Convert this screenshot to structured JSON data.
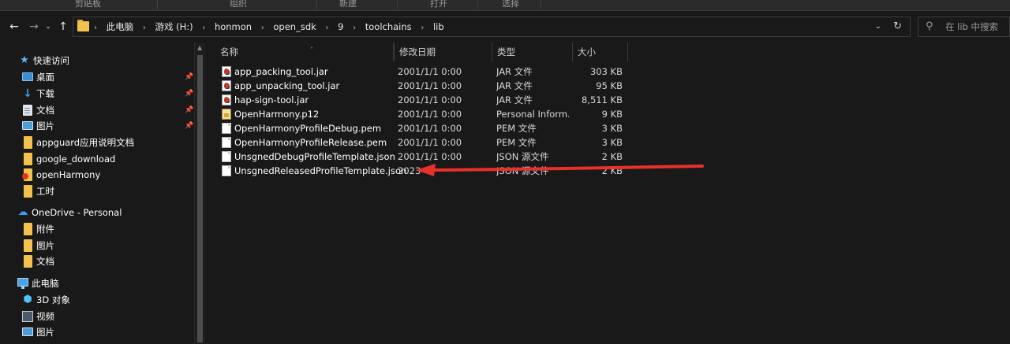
{
  "ribbon": {
    "groups": [
      "剪贴板",
      "组织",
      "新建",
      "打开",
      "选择"
    ]
  },
  "nav": {
    "back_icon": "arrow-left-icon",
    "forward_icon": "arrow-right-icon",
    "recent_icon": "chevron-down-icon",
    "up_icon": "arrow-up-icon"
  },
  "address": {
    "crumbs": [
      "此电脑",
      "游戏 (H:)",
      "honmon",
      "open_sdk",
      "9",
      "toolchains",
      "lib"
    ],
    "separator": "›"
  },
  "search": {
    "placeholder": "在 lib 中搜索"
  },
  "sidebar": {
    "quick_access": {
      "label": "快速访问",
      "items": [
        {
          "label": "桌面",
          "icon": "desktop-icon",
          "pinned": true
        },
        {
          "label": "下载",
          "icon": "download-icon",
          "pinned": true
        },
        {
          "label": "文档",
          "icon": "document-icon",
          "pinned": true
        },
        {
          "label": "图片",
          "icon": "pictures-icon",
          "pinned": true
        },
        {
          "label": "appguard应用说明文档",
          "icon": "folder-icon",
          "pinned": false
        },
        {
          "label": "google_download",
          "icon": "folder-icon",
          "pinned": false
        },
        {
          "label": "openHarmony",
          "icon": "folder-icon",
          "pinned": false
        },
        {
          "label": "工时",
          "icon": "folder-icon",
          "pinned": false
        }
      ]
    },
    "onedrive": {
      "label": "OneDrive - Personal",
      "items": [
        {
          "label": "附件",
          "icon": "folder-icon"
        },
        {
          "label": "图片",
          "icon": "folder-icon"
        },
        {
          "label": "文档",
          "icon": "folder-icon"
        }
      ]
    },
    "this_pc": {
      "label": "此电脑",
      "items": [
        {
          "label": "3D 对象",
          "icon": "3d-objects-icon"
        },
        {
          "label": "视频",
          "icon": "video-icon"
        },
        {
          "label": "图片",
          "icon": "pictures-icon"
        }
      ]
    }
  },
  "columns": {
    "name": "名称",
    "date": "修改日期",
    "type": "类型",
    "size": "大小"
  },
  "files": [
    {
      "name": "app_packing_tool.jar",
      "date": "2001/1/1 0:00",
      "type": "JAR 文件",
      "size": "303 KB",
      "icon": "jar-file-icon"
    },
    {
      "name": "app_unpacking_tool.jar",
      "date": "2001/1/1 0:00",
      "type": "JAR 文件",
      "size": "95 KB",
      "icon": "jar-file-icon"
    },
    {
      "name": "hap-sign-tool.jar",
      "date": "2001/1/1 0:00",
      "type": "JAR 文件",
      "size": "8,511 KB",
      "icon": "jar-file-icon"
    },
    {
      "name": "OpenHarmony.p12",
      "date": "2001/1/1 0:00",
      "type": "Personal Inform...",
      "size": "9 KB",
      "icon": "certificate-file-icon"
    },
    {
      "name": "OpenHarmonyProfileDebug.pem",
      "date": "2001/1/1 0:00",
      "type": "PEM 文件",
      "size": "3 KB",
      "icon": "blank-file-icon"
    },
    {
      "name": "OpenHarmonyProfileRelease.pem",
      "date": "2001/1/1 0:00",
      "type": "PEM 文件",
      "size": "3 KB",
      "icon": "blank-file-icon"
    },
    {
      "name": "UnsgnedDebugProfileTemplate.json",
      "date": "2001/1/1 0:00",
      "type": "JSON 源文件",
      "size": "2 KB",
      "icon": "blank-file-icon"
    },
    {
      "name": "UnsgnedReleasedProfileTemplate.json",
      "date": "2023",
      "type": "JSON 源文件",
      "size": "2 KB",
      "icon": "blank-file-icon"
    }
  ],
  "annotation": {
    "arrow_color": "#e8312a",
    "target_row": "UnsgnedReleasedProfileTemplate.json"
  },
  "colors": {
    "background": "#191919",
    "folder": "#f2c14e",
    "accent": "#3d9ae8"
  }
}
